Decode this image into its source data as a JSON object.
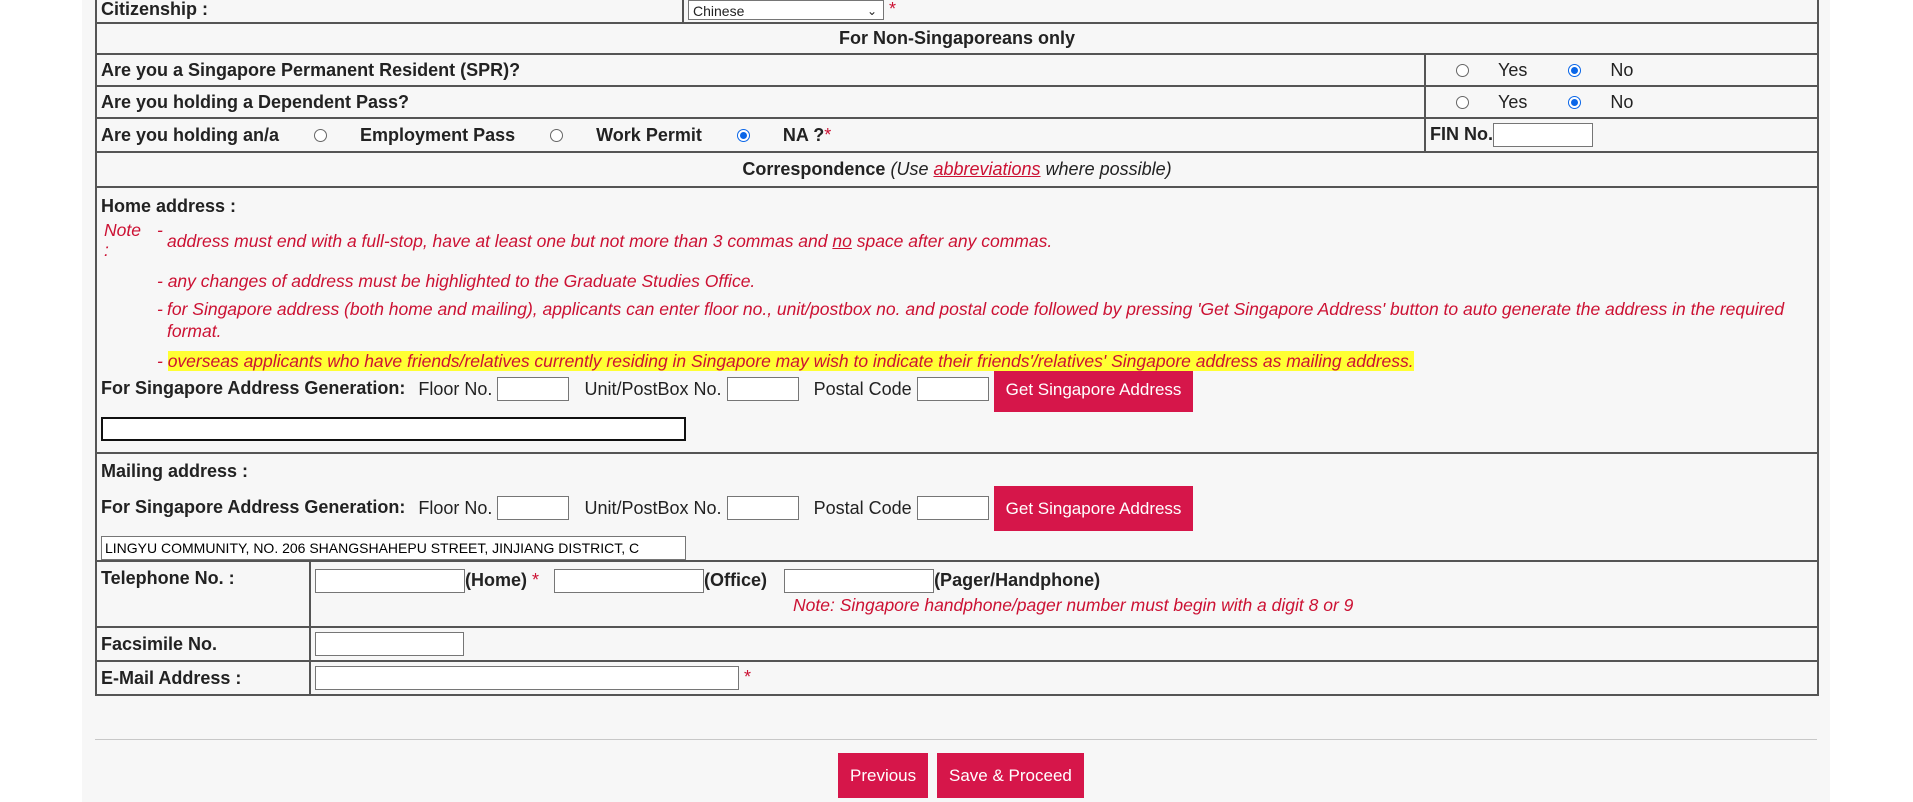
{
  "citizenship": {
    "label": "Citizenship :",
    "value": "Chinese",
    "required": "*"
  },
  "non_sg": {
    "header": "For Non-Singaporeans only",
    "spr_question": "Are you a Singapore Permanent Resident (SPR)?",
    "dep_pass_question": "Are you holding a Dependent Pass?",
    "yes": "Yes",
    "no": "No",
    "holding_label": "Are you holding an/a",
    "employment_pass": "Employment Pass",
    "work_permit": "Work Permit",
    "na": "NA ?",
    "required": "*",
    "fin_label": "FIN No."
  },
  "correspondence": {
    "header_main": "Correspondence",
    "header_pre": "(Use ",
    "header_link": "abbreviations",
    "header_post": " where possible)"
  },
  "home_address": {
    "label": "Home address :",
    "note_label": "Note :",
    "dash": "-",
    "note1_pre": "address must end with a full-stop, have at least one but not more than 3 commas and ",
    "note1_u": "no",
    "note1_post": " space after any commas.",
    "note2": "any changes of address must be highlighted to the Graduate Studies Office.",
    "note3": "for Singapore address (both home and mailing), applicants can enter floor no., unit/postbox no. and postal code followed by pressing 'Get Singapore Address' button to auto generate the address in the required format.",
    "note4": "overseas applicants who have friends/relatives currently residing in Singapore may wish to indicate their friends'/relatives' Singapore address as mailing address.",
    "address_value": ""
  },
  "generation": {
    "label": "For Singapore Address Generation:",
    "floor": "Floor No.",
    "unit": "Unit/PostBox No.",
    "postal": "Postal Code",
    "button": "Get Singapore Address"
  },
  "mailing_address": {
    "label": "Mailing address :",
    "address_value": "LINGYU COMMUNITY, NO. 206 SHANGSHAHEPU STREET, JINJIANG DISTRICT, C"
  },
  "telephone": {
    "label": "Telephone No. :",
    "home": "(Home)",
    "office": "(Office)",
    "pager": "(Pager/Handphone)",
    "required": "*",
    "note": "Note: Singapore handphone/pager number must begin with a digit 8 or 9"
  },
  "fax": {
    "label": "Facsimile No."
  },
  "email": {
    "label": "E-Mail Address :",
    "required": "*"
  },
  "actions": {
    "previous": "Previous",
    "save": "Save & Proceed"
  },
  "colors": {
    "accent": "#d6164a",
    "note_red": "#cc1133",
    "highlight": "#ffff33",
    "radio_blue": "#0a66e8"
  }
}
